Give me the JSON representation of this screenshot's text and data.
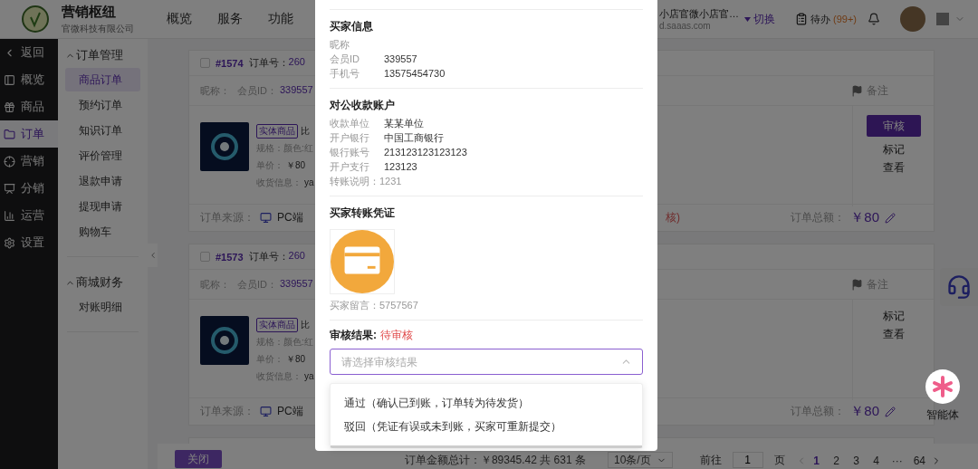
{
  "header": {
    "brand": "营销枢纽",
    "company": "官微科技有限公司",
    "nav": [
      {
        "label": "概览"
      },
      {
        "label": "服务"
      },
      {
        "label": "功能"
      }
    ],
    "shop_name": "小店官微小店官…",
    "shop_domain": "d.saaas.com",
    "switch": "切换",
    "todo": {
      "label": "待办",
      "count": "(99+)"
    }
  },
  "main_nav": [
    {
      "label": "返回",
      "selected": false
    },
    {
      "label": "概览",
      "selected": false
    },
    {
      "label": "商品",
      "selected": false
    },
    {
      "label": "订单",
      "selected": true
    },
    {
      "label": "营销",
      "selected": false
    },
    {
      "label": "分销",
      "selected": false
    },
    {
      "label": "运营",
      "selected": false
    },
    {
      "label": "设置",
      "selected": false
    }
  ],
  "sub_nav": [
    {
      "title": "订单管理",
      "expanded": true,
      "items": [
        {
          "label": "商品订单",
          "selected": true
        },
        {
          "label": "预约订单",
          "selected": false
        },
        {
          "label": "知识订单",
          "selected": false
        },
        {
          "label": "评价管理",
          "selected": false
        },
        {
          "label": "退款申请",
          "selected": false
        },
        {
          "label": "提现申请",
          "selected": false
        },
        {
          "label": "购物车",
          "selected": false
        }
      ]
    },
    {
      "title": "商城财务",
      "expanded": true,
      "items": [
        {
          "label": "对账明细",
          "selected": false
        }
      ]
    }
  ],
  "orders": [
    {
      "checked": false,
      "number": "#1574",
      "order_no_label": "订单号：",
      "order_no": "260",
      "nickname_label": "昵称：",
      "member_label": "会员ID：",
      "member_id": "339557",
      "note": "备注",
      "tag": "实体商品",
      "product_name": "比",
      "spec": "规格：颜色:红",
      "price_label": "单价：",
      "price": "￥80",
      "shipping_label": "收货信息：",
      "shipping": "ya",
      "source_label": "订单来源：",
      "source": "PC端",
      "status": "核)",
      "actions": [
        {
          "label": "审核",
          "kind": "primary"
        },
        {
          "label": "标记",
          "kind": "link"
        },
        {
          "label": "查看",
          "kind": "link"
        }
      ],
      "total_label": "订单总额：",
      "total": "￥80"
    },
    {
      "checked": false,
      "number": "#1573",
      "order_no_label": "订单号：",
      "order_no": "260",
      "nickname_label": "昵称：",
      "member_label": "会员ID：",
      "member_id": "339557",
      "note": "备注",
      "tag": "实体商品",
      "product_name": "比",
      "spec": "规格：颜色:红",
      "price_label": "单价：",
      "price": "￥80",
      "shipping_label": "收货信息：",
      "shipping": "ya",
      "source_label": "订单来源：",
      "source": "PC端",
      "actions": [
        {
          "label": "标记",
          "kind": "link"
        },
        {
          "label": "查看",
          "kind": "link"
        }
      ],
      "total_label": "订单总额：",
      "total": "￥80"
    }
  ],
  "footer": {
    "close": "关闭",
    "summary": "订单金额总计：￥89345.42 共 631 条",
    "page_size": "10条/页",
    "goto_label": "前往",
    "goto_value": "1",
    "goto_suffix": "页",
    "pages": [
      {
        "label": "1",
        "selected": true
      },
      {
        "label": "2",
        "selected": false
      },
      {
        "label": "3",
        "selected": false
      },
      {
        "label": "4",
        "selected": false
      },
      {
        "label": "···",
        "selected": false
      },
      {
        "label": "64",
        "selected": false
      }
    ]
  },
  "dialog": {
    "buyer": {
      "title": "买家信息",
      "rows": [
        {
          "label": "昵称"
        },
        {
          "label": "会员ID",
          "value": "339557"
        },
        {
          "label": "手机号",
          "value": "13575454730"
        }
      ]
    },
    "account": {
      "title": "对公收款账户",
      "rows": [
        {
          "label": "收款单位",
          "value": "某某单位"
        },
        {
          "label": "开户银行",
          "value": "中国工商银行"
        },
        {
          "label": "银行账号",
          "value": "213123123123123"
        },
        {
          "label": "开户支行",
          "value": "123123"
        }
      ],
      "remark": "转账说明：1231"
    },
    "proof": {
      "title": "买家转账凭证",
      "message": "买家留言：5757567"
    },
    "review": {
      "label": "审核结果:",
      "status": "待审核",
      "placeholder": "请选择审核结果",
      "expanded": true,
      "options": [
        {
          "label": "通过（确认已到账，订单转为待发货）",
          "selected": false
        },
        {
          "label": "驳回（凭证有误或未到账，买家可重新提交）",
          "selected": false
        }
      ]
    }
  },
  "assistant": {
    "label": "智能体"
  }
}
